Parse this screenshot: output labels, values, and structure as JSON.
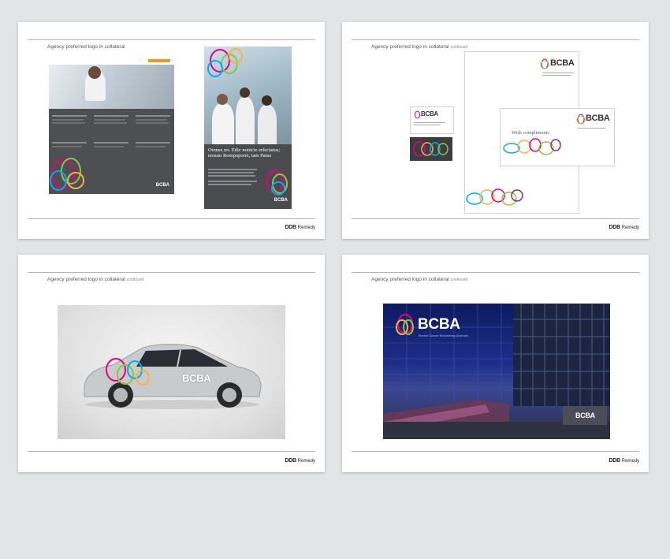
{
  "slides": [
    {
      "heading": "Agency preferred logo in collateral",
      "sub": "",
      "agency": "Remedy"
    },
    {
      "heading": "Agency preferred logo in collateral",
      "sub": "continued",
      "agency": "Remedy"
    },
    {
      "heading": "Agency preferred logo in collateral",
      "sub": "continued",
      "agency": "Remedy"
    },
    {
      "heading": "Agency preferred logo in collateral",
      "sub": "continued",
      "agency": "Remedy"
    }
  ],
  "agency_mark": "DDB",
  "brand": "BCBA",
  "poster_headline": "Omnes no. Edic nonicie erfectatus; nosum Rompoporet, tam Patus",
  "compliments": "With compliments",
  "building_tagline": "Breast Cancer Biobanking Australia",
  "colors": {
    "slide_bg": "#ffffff",
    "page_bg": "#e3e4e6",
    "dark_panel": "#4e4f52",
    "accent_orange": "#f7941e"
  }
}
